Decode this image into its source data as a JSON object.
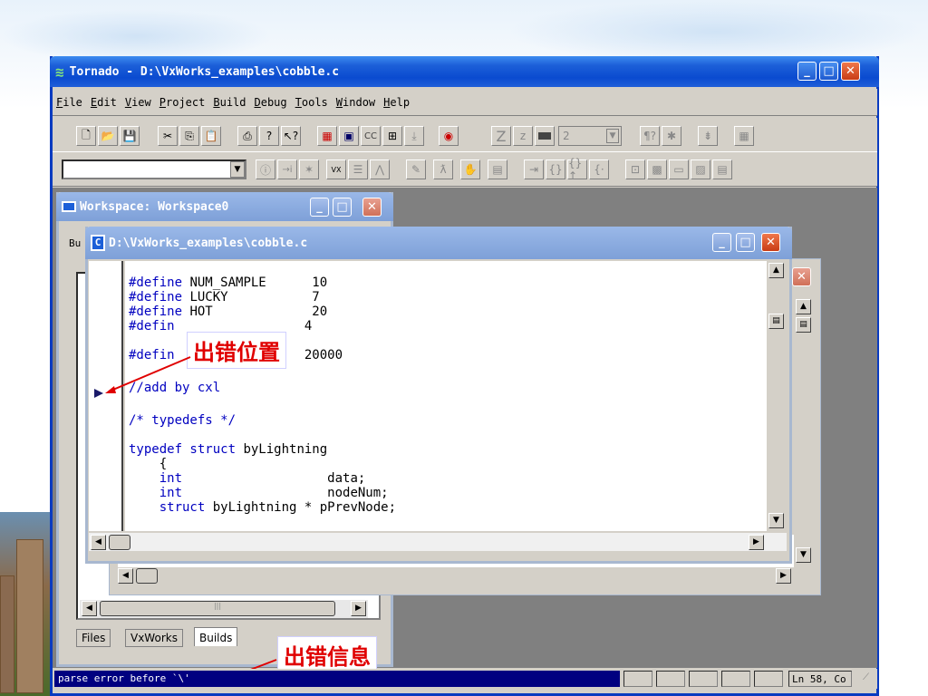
{
  "main_window": {
    "title": "Tornado - D:\\VxWorks_examples\\cobble.c",
    "menu": [
      {
        "label": "File",
        "key": "F"
      },
      {
        "label": "Edit",
        "key": "E"
      },
      {
        "label": "View",
        "key": "V"
      },
      {
        "label": "Project",
        "key": "P"
      },
      {
        "label": "Build",
        "key": "B"
      },
      {
        "label": "Debug",
        "key": "D"
      },
      {
        "label": "Tools",
        "key": "T"
      },
      {
        "label": "Window",
        "key": "W"
      },
      {
        "label": "Help",
        "key": "H"
      }
    ],
    "toolbar": {
      "combo_value": "2",
      "cc_label": "CC"
    }
  },
  "workspace": {
    "title": "Workspace: Workspace0",
    "stub_label": "Bu",
    "tabs": [
      "Files",
      "VxWorks",
      "Builds"
    ]
  },
  "editor": {
    "title": "D:\\VxWorks_examples\\cobble.c",
    "lines": [
      {
        "kw": "#define",
        "rest": " NUM_SAMPLE      10"
      },
      {
        "kw": "#define",
        "rest": " LUCKY           7"
      },
      {
        "kw": "#define",
        "rest": " HOT             20"
      },
      {
        "kw": "#defin",
        "rest": "                 4"
      },
      {
        "kw": "#defin",
        "rest": "                 20000"
      },
      {
        "comment": "//add by cxl"
      },
      {
        "comment": "/* typedefs */"
      },
      {
        "kw": "typedef struct",
        "rest": " byLightning"
      },
      {
        "rest": "    {"
      },
      {
        "kw": "    int",
        "rest": "                   data;"
      },
      {
        "kw": "    int",
        "rest": "                   nodeNum;"
      },
      {
        "kw": "    struct",
        "rest": " byLightning * pPrevNode;"
      }
    ]
  },
  "callouts": {
    "error_position": "出错位置",
    "error_message": "出错信息"
  },
  "status_bar": {
    "message": "parse error before `\\'",
    "position": "Ln 58, Co"
  }
}
